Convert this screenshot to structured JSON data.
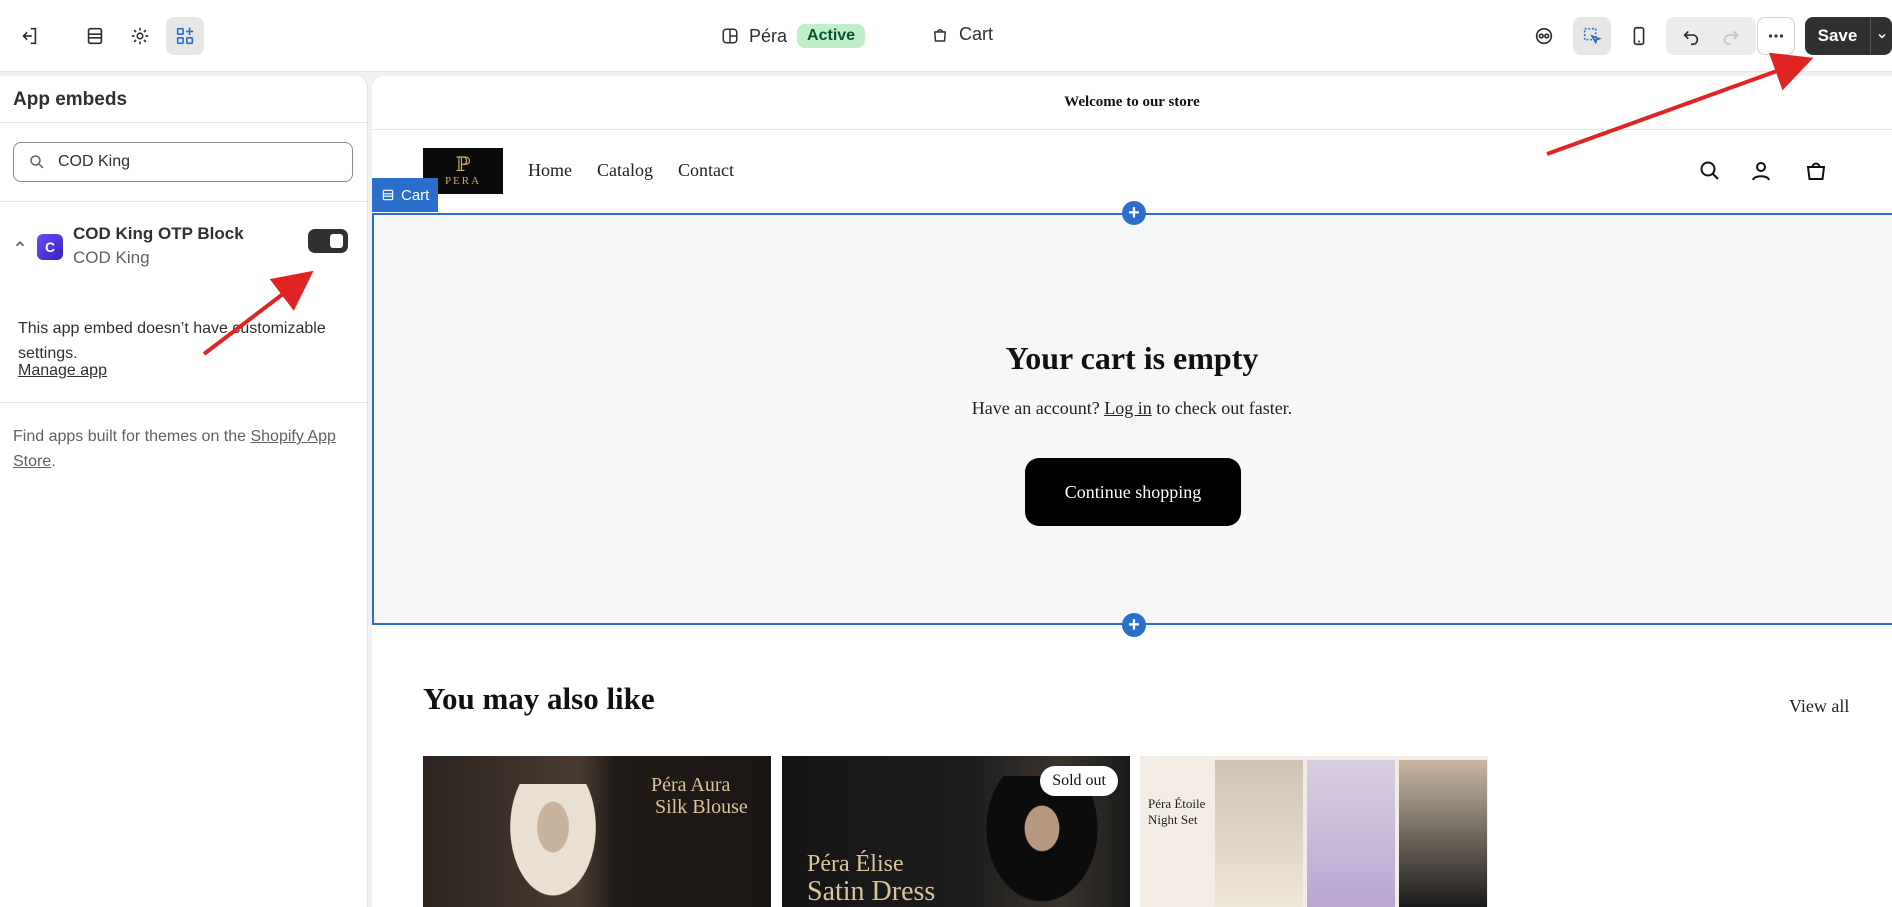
{
  "topbar": {
    "theme_name": "Péra",
    "theme_status": "Active",
    "page_name": "Cart",
    "save_label": "Save"
  },
  "panel": {
    "title": "App embeds",
    "search_value": "COD King",
    "app": {
      "name": "COD King OTP Block",
      "vendor": "COD King",
      "enabled": true,
      "note": "This app embed doesn’t have customizable settings.",
      "manage_label": "Manage app"
    },
    "find_apps_prefix": "Find apps built for themes on the ",
    "find_apps_link": "Shopify App Store",
    "find_apps_suffix": "."
  },
  "preview": {
    "announcement": "Welcome to our store",
    "logo_text": "PERA",
    "nav": [
      "Home",
      "Catalog",
      "Contact"
    ],
    "section_tag": "Cart",
    "cart_title": "Your cart is empty",
    "login_prefix": "Have an account? ",
    "login_link": "Log in",
    "login_suffix": " to check out faster.",
    "continue_label": "Continue shopping",
    "also_like_title": "You may also like",
    "view_all": "View all",
    "products": [
      {
        "caption_line1": "Péra Aura",
        "caption_line2": "Silk Blouse",
        "badge": ""
      },
      {
        "caption_line1": "Péra Élise",
        "caption_line2": "Satin Dress",
        "badge": "Sold out"
      },
      {
        "caption_line1": "Péra Étoile",
        "caption_line2": "Night Set",
        "badge": ""
      }
    ]
  },
  "colors": {
    "accent_blue": "#2c6ecb",
    "annotation_red": "#e02424",
    "active_badge_bg": "#bff0c8"
  }
}
